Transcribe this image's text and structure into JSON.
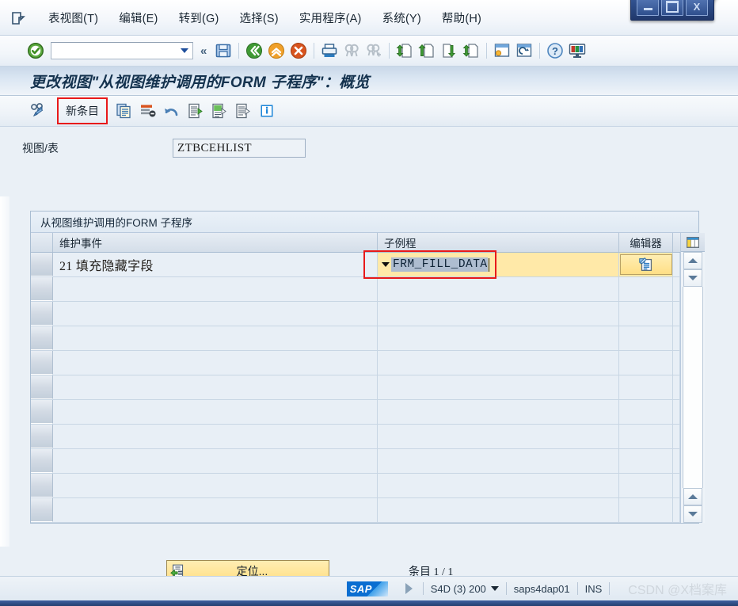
{
  "window": {
    "minimize_label": "minimize",
    "maximize_label": "maximize",
    "close_label": "X"
  },
  "menubar": {
    "system_icon": "system-menu-icon",
    "items": [
      {
        "label": "表视图(T)"
      },
      {
        "label": "编辑(E)"
      },
      {
        "label": "转到(G)"
      },
      {
        "label": "选择(S)"
      },
      {
        "label": "实用程序(A)"
      },
      {
        "label": "系统(Y)"
      },
      {
        "label": "帮助(H)"
      }
    ]
  },
  "toolbar": {
    "ok_icon": "green-check-icon",
    "command_field_value": "",
    "command_field_placeholder": "",
    "expand_label": "«",
    "icons": [
      "save-icon",
      "back-icon",
      "exit-icon",
      "cancel-icon",
      "print-icon",
      "find-icon",
      "find-next-icon",
      "first-page-icon",
      "previous-page-icon",
      "next-page-icon",
      "last-page-icon",
      "create-session-icon",
      "create-shortcut-icon",
      "help-icon",
      "customize-local-layout-icon"
    ]
  },
  "title": {
    "text": "更改视图\"从视图维护调用的FORM 子程序\"：概览"
  },
  "apptoolbar": {
    "inspect_icon": "check-glasses-icon",
    "new_entry_label": "新条目",
    "icons": [
      "copy-as-icon",
      "delete-icon",
      "undo-icon",
      "select-all-icon",
      "select-block-icon",
      "deselect-all-icon",
      "details-icon"
    ]
  },
  "form": {
    "view_table_label": "视图/表",
    "view_table_value": "ZTBCEHLIST"
  },
  "grid": {
    "caption": "从视图维护调用的FORM 子程序",
    "columns": [
      {
        "key": "select",
        "label": ""
      },
      {
        "key": "event",
        "label": "维护事件"
      },
      {
        "key": "subroutine",
        "label": "子例程"
      },
      {
        "key": "editor",
        "label": "编辑器"
      }
    ],
    "rows": [
      {
        "event": "21  填充隐藏字段",
        "subroutine": "FRM_FILL_DATA",
        "editor_icon": "editor-document-icon",
        "highlighted": true
      }
    ],
    "empty_row_count": 10,
    "config_icon": "table-settings-icon",
    "scroll_up_icon": "scroll-up-arrow",
    "scroll_down_icon": "scroll-down-arrow"
  },
  "footer": {
    "position_icon": "position-icon",
    "position_label": "定位...",
    "entry_count": "条目 1 / 1"
  },
  "statusbar": {
    "logo": "SAP",
    "servertray_icon": "session-icon",
    "system": "S4D (3) 200",
    "server": "saps4dap01",
    "insert_mode": "INS",
    "watermark": "CSDN @X档案库"
  },
  "colors": {
    "accent_red": "#e8191a",
    "highlight_yellow": "#ffe9a8",
    "selection_blue": "#aebdd0",
    "sap_blue": "#0a6ed1"
  }
}
